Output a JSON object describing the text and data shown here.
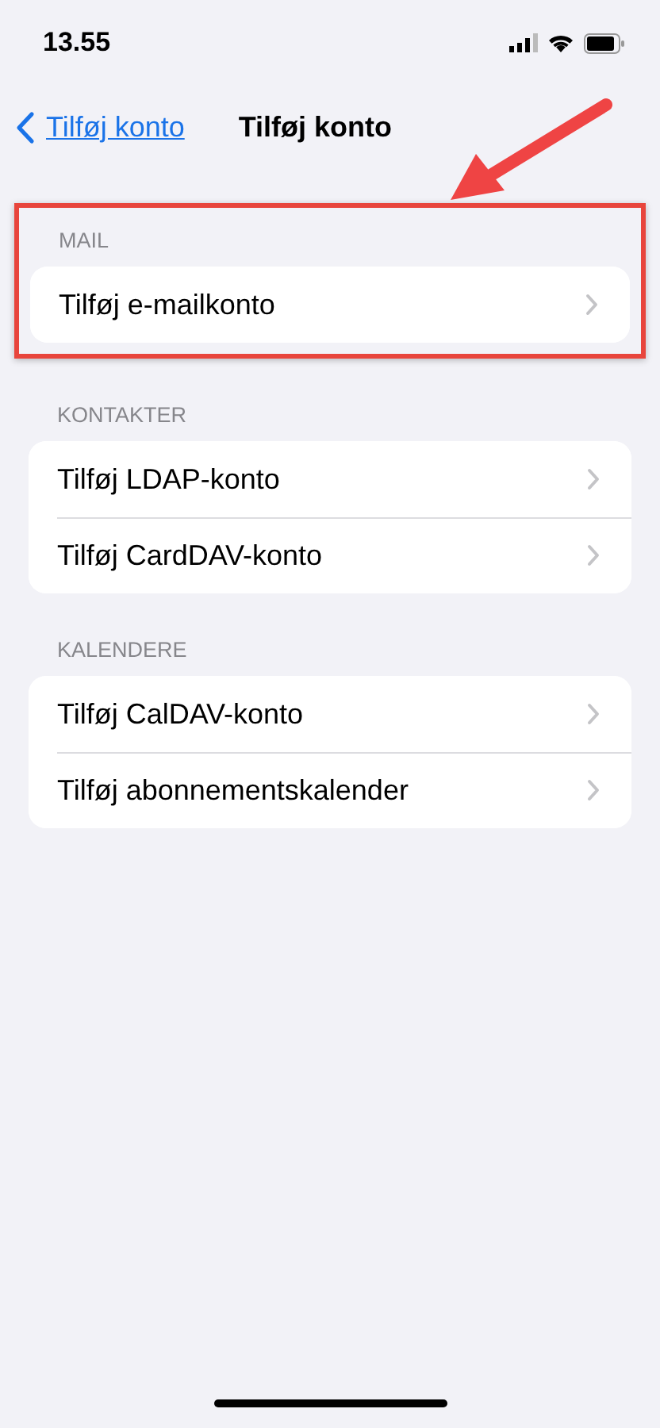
{
  "status_bar": {
    "time": "13.55"
  },
  "nav": {
    "back_label": "Tilføj konto",
    "title": "Tilføj konto"
  },
  "sections": [
    {
      "header": "MAIL",
      "highlighted": true,
      "items": [
        "Tilføj e-mailkonto"
      ]
    },
    {
      "header": "KONTAKTER",
      "highlighted": false,
      "items": [
        "Tilføj LDAP-konto",
        "Tilføj CardDAV-konto"
      ]
    },
    {
      "header": "KALENDERE",
      "highlighted": false,
      "items": [
        "Tilføj CalDAV-konto",
        "Tilføj abonnementskalender"
      ]
    }
  ]
}
